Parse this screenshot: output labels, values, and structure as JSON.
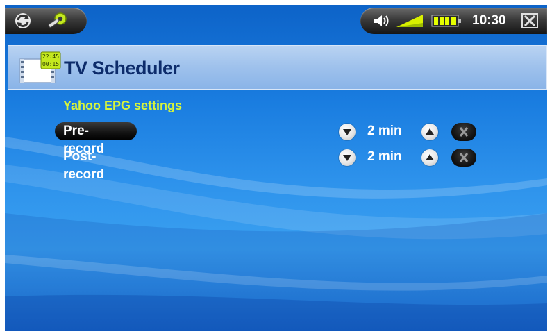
{
  "status": {
    "time": "10:30",
    "battery_level": 0.9,
    "signal_level": 1.0
  },
  "header": {
    "title": "TV Scheduler",
    "icon_times": [
      "22:45",
      "00:15"
    ]
  },
  "section": {
    "title": "Yahoo EPG settings"
  },
  "settings": [
    {
      "label": "Pre-record",
      "value": "2 min",
      "selected": true
    },
    {
      "label": "Post-record",
      "value": "2 min",
      "selected": false
    }
  ],
  "colors": {
    "accent": "#d8f53a",
    "title": "#0d2c6b",
    "battery": "#e6ff00"
  },
  "icons": {
    "back": "refresh-back-icon",
    "tools": "tools-gear-icon",
    "volume": "speaker-icon",
    "signal": "signal-icon",
    "battery": "battery-icon",
    "close": "close-icon",
    "decrease": "arrow-down-icon",
    "increase": "arrow-up-icon",
    "reset": "x-icon"
  }
}
